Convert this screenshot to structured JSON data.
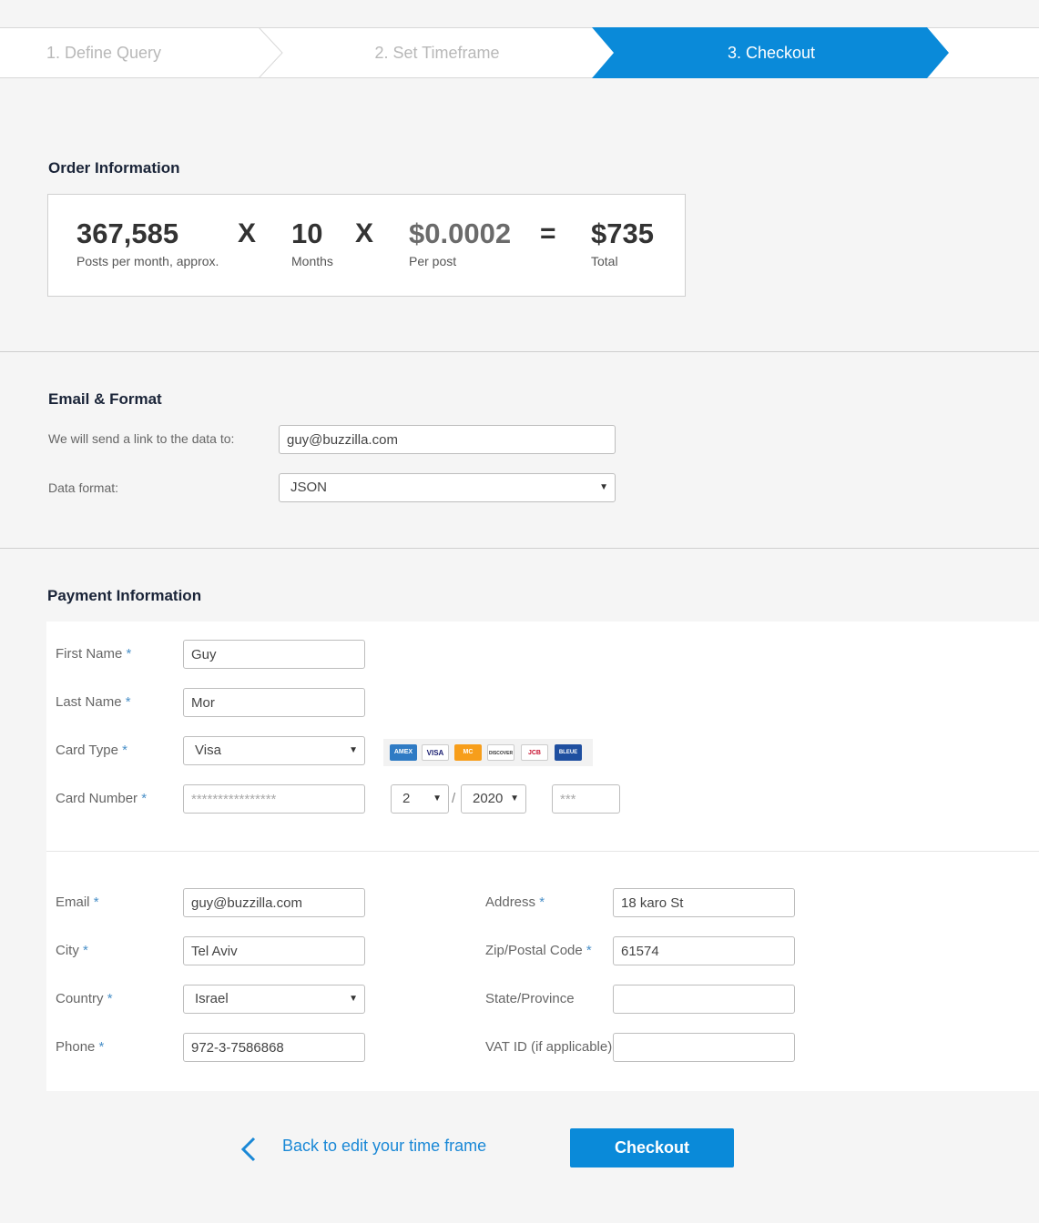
{
  "stepper": {
    "steps": [
      "1. Define Query",
      "2. Set Timeframe",
      "3. Checkout"
    ],
    "active_color": "#0a8ad9"
  },
  "order": {
    "heading": "Order Information",
    "posts_value": "367,585",
    "posts_label": "Posts per month, approx.",
    "op_times": "X",
    "months_value": "10",
    "months_label": "Months",
    "price_value": "$0.0002",
    "price_label": "Per post",
    "op_equals": "=",
    "total_value": "$735",
    "total_label": "Total"
  },
  "email_format": {
    "heading": "Email & Format",
    "send_label": "We will send a link to the data to:",
    "send_value": "guy@buzzilla.com",
    "format_label": "Data format:",
    "format_value": "JSON"
  },
  "payment": {
    "heading": "Payment Information",
    "required_mark": "*",
    "first_name_label": "First Name",
    "first_name_value": "Guy",
    "last_name_label": "Last Name",
    "last_name_value": "Mor",
    "card_type_label": "Card Type",
    "card_type_value": "Visa",
    "card_number_label": "Card Number",
    "card_number_placeholder": "****************",
    "exp_month": "2",
    "exp_slash": "/",
    "exp_year": "2020",
    "cvv_placeholder": "***",
    "cards": [
      "AMEX",
      "VISA",
      "MC",
      "DISCOVER",
      "JCB",
      "BLEUE"
    ],
    "email_label": "Email",
    "email_value": "guy@buzzilla.com",
    "city_label": "City",
    "city_value": "Tel Aviv",
    "country_label": "Country",
    "country_value": "Israel",
    "phone_label": "Phone",
    "phone_value": "972-3-7586868",
    "address_label": "Address",
    "address_value": "18 karo St",
    "zip_label": "Zip/Postal Code",
    "zip_value": "61574",
    "state_label": "State/Province",
    "state_value": "",
    "vat_label": "VAT ID (if applicable)",
    "vat_value": ""
  },
  "footer": {
    "back_label": "Back to edit your time frame",
    "checkout_label": "Checkout"
  }
}
